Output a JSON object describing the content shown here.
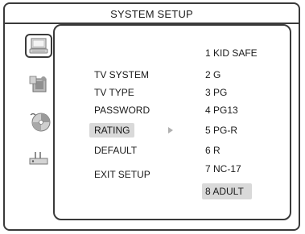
{
  "header": {
    "title": "SYSTEM SETUP"
  },
  "sidebar": {
    "icons": [
      {
        "name": "system-setup-icon",
        "active": true
      },
      {
        "name": "language-setup-icon",
        "active": false
      },
      {
        "name": "audio-setup-icon",
        "active": false
      },
      {
        "name": "preference-setup-icon",
        "active": false
      }
    ]
  },
  "menu": {
    "items": [
      {
        "label": "TV SYSTEM",
        "selected": false
      },
      {
        "label": "TV TYPE",
        "selected": false
      },
      {
        "label": "PASSWORD",
        "selected": false
      },
      {
        "label": "RATING",
        "selected": true
      },
      {
        "label": "DEFAULT",
        "selected": false
      },
      {
        "label": "EXIT SETUP",
        "selected": false
      }
    ]
  },
  "options": {
    "items": [
      {
        "label": "1 KID SAFE",
        "selected": false
      },
      {
        "label": "2 G",
        "selected": false
      },
      {
        "label": "3 PG",
        "selected": false
      },
      {
        "label": "4 PG13",
        "selected": false
      },
      {
        "label": "5 PG-R",
        "selected": false
      },
      {
        "label": "6 R",
        "selected": false
      },
      {
        "label": "7 NC-17",
        "selected": false
      },
      {
        "label": "8 ADULT",
        "selected": true
      }
    ]
  },
  "colors": {
    "border": "#3a3a3a",
    "highlight": "#d9d9d9",
    "text": "#1a1a1a"
  }
}
